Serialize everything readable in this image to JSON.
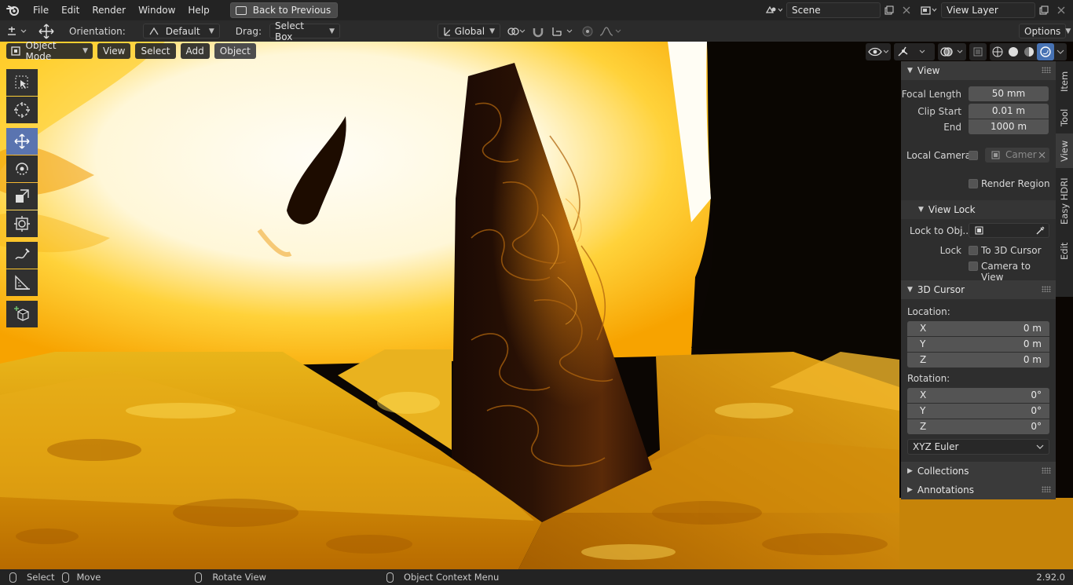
{
  "menubar": {
    "items": [
      "File",
      "Edit",
      "Render",
      "Window",
      "Help"
    ],
    "back_button": "Back to Previous",
    "scene_name": "Scene",
    "view_layer": "View Layer"
  },
  "tool_header": {
    "orientation_label": "Orientation:",
    "orientation_value": "Default",
    "drag_label": "Drag:",
    "drag_value": "Select Box",
    "transform_orientation": "Global",
    "options": "Options"
  },
  "viewport_header": {
    "mode": "Object Mode",
    "menus": [
      "View",
      "Select",
      "Add",
      "Object"
    ]
  },
  "sidebar_tabs": [
    "Item",
    "Tool",
    "View",
    "Easy HDRI",
    "Edit"
  ],
  "npanel": {
    "view": {
      "title": "View",
      "focal_length_label": "Focal Length",
      "focal_length": "50 mm",
      "clip_start_label": "Clip Start",
      "clip_start": "0.01 m",
      "clip_end_label": "End",
      "clip_end": "1000 m",
      "local_camera_label": "Local Camera",
      "local_camera_value": "Camer",
      "render_region_label": "Render Region"
    },
    "view_lock": {
      "title": "View Lock",
      "lock_to_object_label": "Lock to Obj...",
      "lock_label": "Lock",
      "to_3d_cursor": "To 3D Cursor",
      "camera_to_view": "Camera to View"
    },
    "cursor": {
      "title": "3D Cursor",
      "location_label": "Location:",
      "location": [
        {
          "axis": "X",
          "value": "0 m"
        },
        {
          "axis": "Y",
          "value": "0 m"
        },
        {
          "axis": "Z",
          "value": "0 m"
        }
      ],
      "rotation_label": "Rotation:",
      "rotation": [
        {
          "axis": "X",
          "value": "0°"
        },
        {
          "axis": "Y",
          "value": "0°"
        },
        {
          "axis": "Z",
          "value": "0°"
        }
      ],
      "rotation_mode": "XYZ Euler"
    },
    "collections_title": "Collections",
    "annotations_title": "Annotations"
  },
  "statusbar": {
    "select": "Select",
    "move": "Move",
    "rotate_view": "Rotate View",
    "context_menu": "Object Context Menu",
    "version": "2.92.0"
  }
}
